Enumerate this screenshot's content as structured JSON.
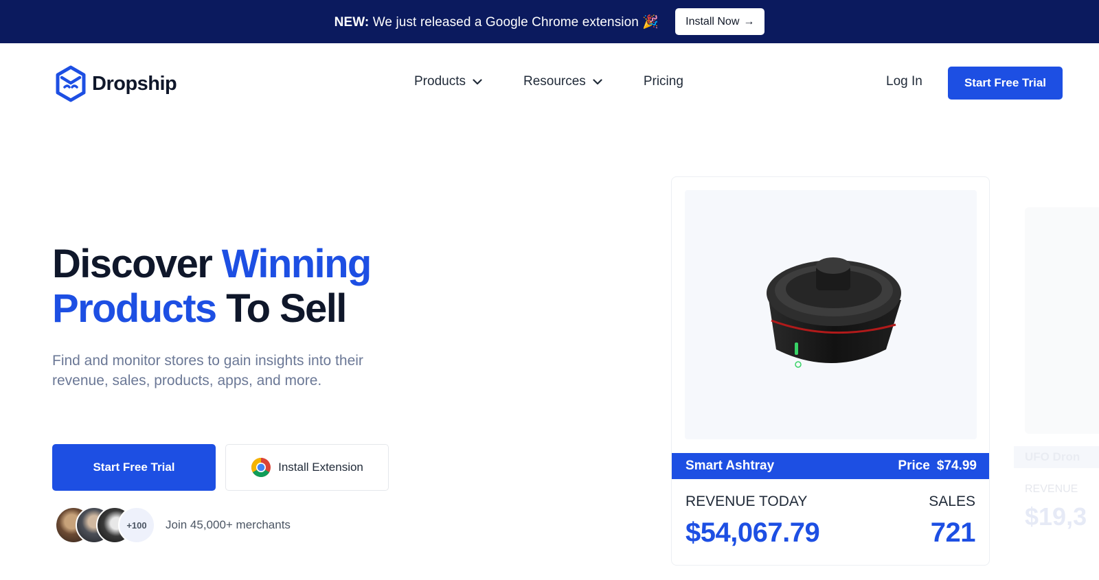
{
  "announcement": {
    "badge": "NEW:",
    "text": "We just released a Google Chrome extension",
    "emoji": "🎉",
    "button_label": "Install Now",
    "button_arrow": "→"
  },
  "header": {
    "logo_text": "Dropship",
    "nav": [
      {
        "label": "Products",
        "has_dropdown": true
      },
      {
        "label": "Resources",
        "has_dropdown": true
      },
      {
        "label": "Pricing",
        "has_dropdown": false
      }
    ],
    "login_label": "Log In",
    "cta_label": "Start Free Trial"
  },
  "hero": {
    "title_part1": "Discover ",
    "title_highlight1": "Winning",
    "title_highlight2": "Products",
    "title_part2": " To Sell",
    "subtitle": "Find and monitor stores to gain insights into their revenue, sales, products, apps, and more.",
    "primary_cta": "Start Free Trial",
    "secondary_cta": "Install Extension",
    "avatar_count": "+100",
    "merchants_text": "Join 45,000+ merchants"
  },
  "product_card": {
    "name": "Smart Ashtray",
    "price_label": "Price",
    "price": "$74.99",
    "revenue_label": "REVENUE TODAY",
    "revenue_value": "$54,067.79",
    "sales_label": "SALES",
    "sales_value": "721"
  },
  "product_card_2": {
    "name": "UFO Dron",
    "revenue_label": "REVENUE",
    "revenue_value": "$19,3"
  },
  "colors": {
    "brand_blue": "#1d4fe3",
    "announce_bg": "#0b1a5e",
    "dark_text": "#0f172a",
    "muted_text": "#6b7896"
  },
  "icons": [
    "logo-icon",
    "chevron-down-icon",
    "chrome-icon",
    "arrow-right-icon"
  ]
}
